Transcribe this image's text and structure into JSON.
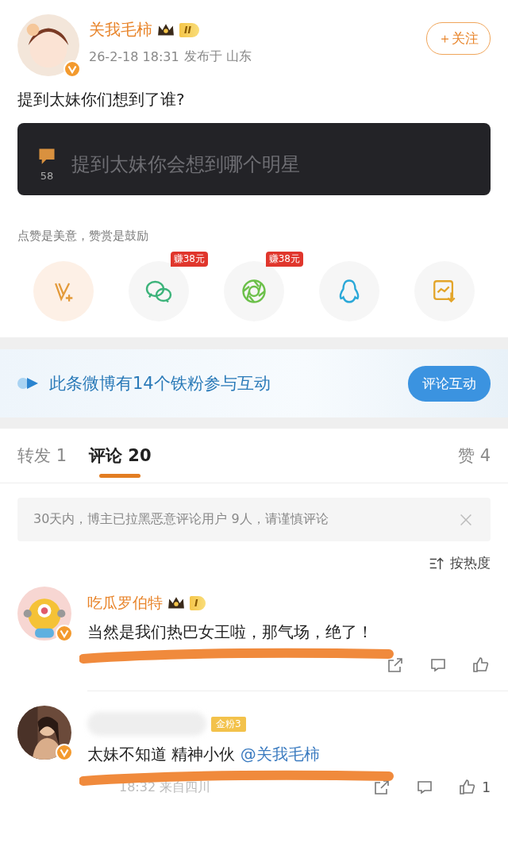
{
  "post": {
    "author": "关我毛柿",
    "level_badge": "II",
    "time": "26-2-18 18:31",
    "location": "发布于 山东",
    "follow_button": "＋关注",
    "text": "提到太妹你们想到了谁?",
    "card": {
      "count": "58",
      "title": "提到太妹你会想到哪个明星"
    }
  },
  "reward_hint": "点赞是美意，赞赏是鼓励",
  "share_actions": [
    {
      "kind": "vplus"
    },
    {
      "kind": "wechat",
      "badge": "赚38元"
    },
    {
      "kind": "moments",
      "badge": "赚38元"
    },
    {
      "kind": "qq"
    },
    {
      "kind": "save_image"
    }
  ],
  "fan_banner": {
    "text": "此条微博有14个铁粉参与互动",
    "button": "评论互动"
  },
  "tabs": [
    {
      "label": "转发 1",
      "selected": false
    },
    {
      "label": "评论 20",
      "selected": true
    },
    {
      "label": "赞 4",
      "selected": false
    }
  ],
  "notice": "30天内，博主已拉黑恶意评论用户 9人，请谨慎评论",
  "sort": "按热度",
  "comments": [
    {
      "author": "吃瓜罗伯特",
      "level_badge": "I",
      "text": "当然是我们热巴女王啦，那气场，绝了！"
    },
    {
      "fan_badge": "金粉3",
      "text": "太妹不知道 精神小伙 ",
      "mention": "@关我毛柿",
      "meta": "18:32 来自四川",
      "likes": "1"
    }
  ]
}
